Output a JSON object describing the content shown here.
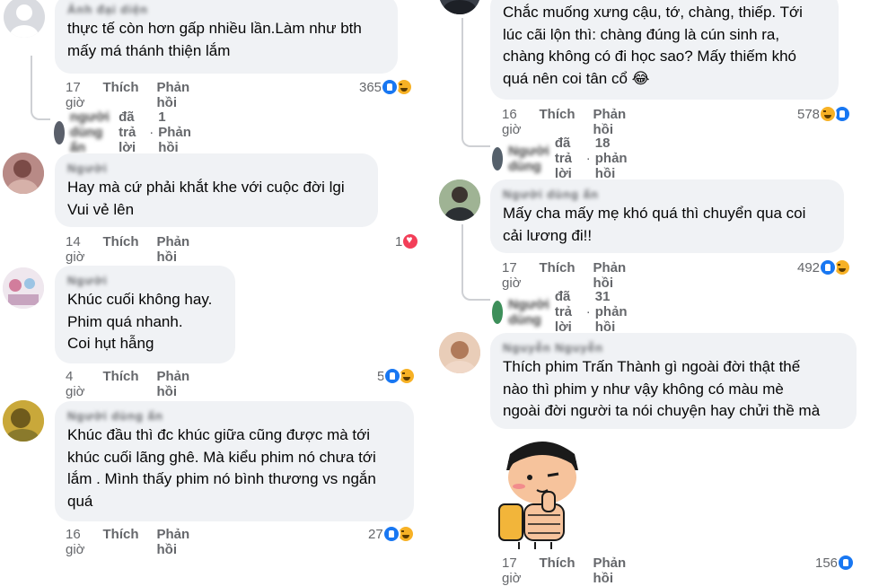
{
  "left_column": [
    {
      "author": "Ảnh đại diện ẩn",
      "text": "thực tế còn hơn gấp nhiều lần.Làm như bth\nmấy má thánh thiện lắm",
      "time": "17 giờ",
      "like_label": "Thích",
      "reply_label": "Phản hồi",
      "reaction_count": "365",
      "reactions": [
        "like-icon",
        "haha-icon"
      ],
      "replies": {
        "replier": "người dùng ẩn",
        "verb": "đã trả lời",
        "count": "1 Phản hồi"
      }
    },
    {
      "author": "Người dùng ẩn",
      "text": "Hay mà cứ phải khắt khe với cuộc đời lgi\nVui vẻ lên",
      "time": "14 giờ",
      "like_label": "Thích",
      "reply_label": "Phản hồi",
      "reaction_count": "1",
      "reactions": [
        "love-icon"
      ]
    },
    {
      "author": "Người dùng",
      "text": "Khúc cuối không hay.\nPhim quá nhanh.\nCoi hụt hẫng",
      "time": "4 giờ",
      "like_label": "Thích",
      "reply_label": "Phản hồi",
      "reaction_count": "5",
      "reactions": [
        "like-icon",
        "haha-icon"
      ]
    },
    {
      "author": "Người dùng ẩn danh",
      "text": "Khúc đầu thì đc khúc giữa cũng được mà tới\nkhúc cuối lãng ghê. Mà kiểu phim nó chưa tới\nlắm . Mình thấy phim nó bình thương vs ngắn\nquá",
      "time": "16 giờ",
      "like_label": "Thích",
      "reply_label": "Phản hồi",
      "reaction_count": "27",
      "reactions": [
        "like-icon",
        "haha-icon"
      ]
    }
  ],
  "right_column": [
    {
      "text": "Chắc muống xưng cậu, tớ, chàng, thiếp. Tới\nlúc cãi lộn thì: chàng đúng là cún sinh ra,\nchàng không có đi học sao? Mấy thiếm khó\nquá nên coi tân cổ 😂",
      "time": "16 giờ",
      "like_label": "Thích",
      "reply_label": "Phản hồi",
      "reaction_count": "578",
      "reactions": [
        "haha-icon",
        "like-icon"
      ],
      "replies": {
        "replier": "Người dùng",
        "verb": "đã trả lời",
        "count": "18 phản hồi"
      }
    },
    {
      "author": "Người dùng ẩn",
      "text": "Mấy cha mấy mẹ khó quá thì chuyển qua coi\ncải lương đi!!",
      "time": "17 giờ",
      "like_label": "Thích",
      "reply_label": "Phản hồi",
      "reaction_count": "492",
      "reactions": [
        "like-icon",
        "haha-icon"
      ],
      "replies": {
        "replier": "Người dùng",
        "verb": "đã trả lời",
        "count": "31 phản hồi"
      }
    },
    {
      "author": "Nguyễn Nguyễn",
      "text": "Thích phim Trấn Thành gì ngoài đời thật thế\nnào thì phim y như vậy không có màu mè\nngoài đời người ta nói chuyện hay chửi thề mà",
      "time": "17 giờ",
      "like_label": "Thích",
      "reply_label": "Phản hồi",
      "reaction_count": "156",
      "reactions": [
        "like-icon"
      ],
      "sticker": "thumbs-up-girl-sticker"
    }
  ],
  "colors": {
    "bubble": "#f0f2f5",
    "meta": "#65676b",
    "like": "#1877f2",
    "haha": "#f7b125",
    "love": "#f33e58"
  }
}
